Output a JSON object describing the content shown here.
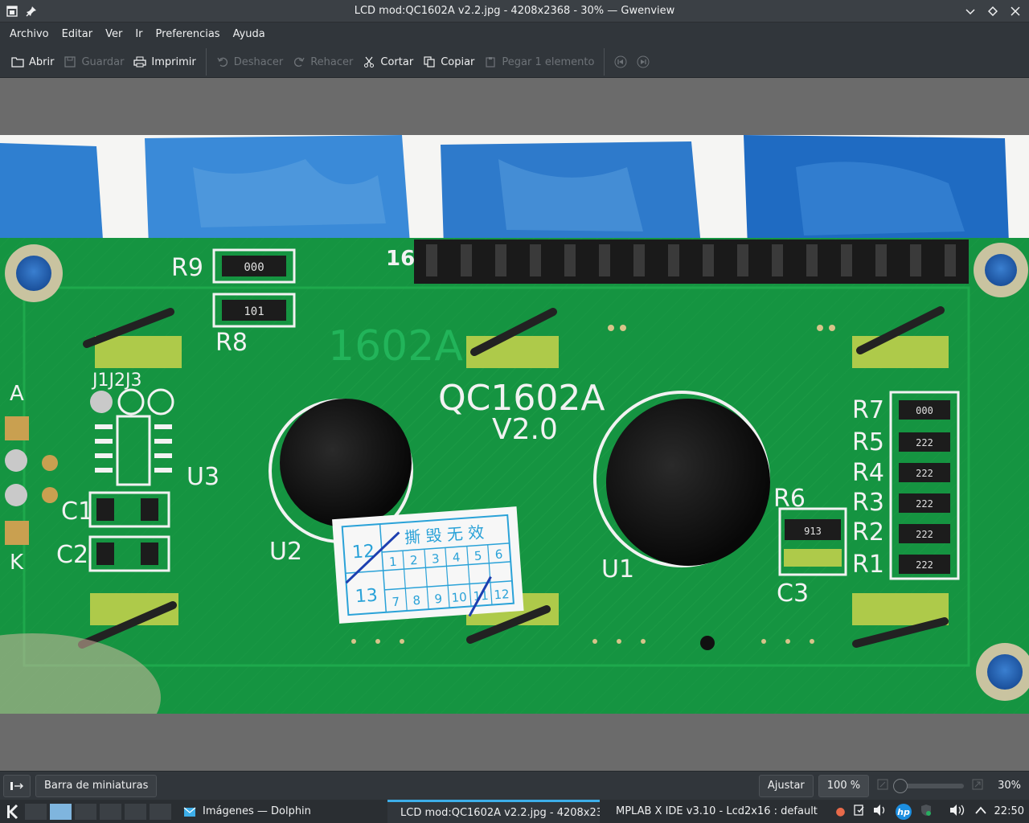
{
  "window": {
    "title": "LCD mod:QC1602A v2.2.jpg - 4208x2368 - 30% — Gwenview"
  },
  "menu": [
    "Archivo",
    "Editar",
    "Ver",
    "Ir",
    "Preferencias",
    "Ayuda"
  ],
  "toolbar": {
    "open": "Abrir",
    "save": "Guardar",
    "print": "Imprimir",
    "undo": "Deshacer",
    "redo": "Rehacer",
    "cut": "Cortar",
    "copy": "Copiar",
    "paste": "Pegar 1 elemento"
  },
  "photo": {
    "board_label": "QC1602A",
    "board_version": "V2.0",
    "silk_1602": "1602A",
    "pin16": "16",
    "sticker": {
      "title": "撕 毁 无 效",
      "left_top": "12",
      "left_bottom": "13",
      "row1": [
        "1",
        "2",
        "3",
        "4",
        "5",
        "6"
      ],
      "row2": [
        "7",
        "8",
        "9",
        "10",
        "11",
        "12"
      ]
    },
    "labels": {
      "r9": "R9",
      "r8": "R8",
      "r7": "R7",
      "r6": "R6",
      "r5": "R5",
      "r4": "R4",
      "r3": "R3",
      "r2": "R2",
      "r1": "R1",
      "u1": "U1",
      "u2": "U2",
      "u3": "U3",
      "c1": "C1",
      "c2": "C2",
      "c3": "C3",
      "j": "J1J2J3",
      "a": "A",
      "k": "K"
    },
    "resistors": {
      "r9": "000",
      "r8": "101",
      "r7": "000",
      "r6": "913",
      "r5": "222",
      "r4": "222",
      "r3": "222",
      "r2": "222",
      "r1": "222"
    }
  },
  "statusbar": {
    "thumbnails": "Barra de miniaturas",
    "fit": "Ajustar",
    "zoom100": "100 %",
    "zoom": "30%",
    "zoom_level": 0.3
  },
  "taskbar": {
    "tasks": [
      "Imágenes — Dolphin",
      "LCD mod:QC1602A v2.2.jpg - 4208x23",
      "MPLAB X IDE v3.10 - Lcd2x16 : default"
    ],
    "clock": "22:50"
  }
}
